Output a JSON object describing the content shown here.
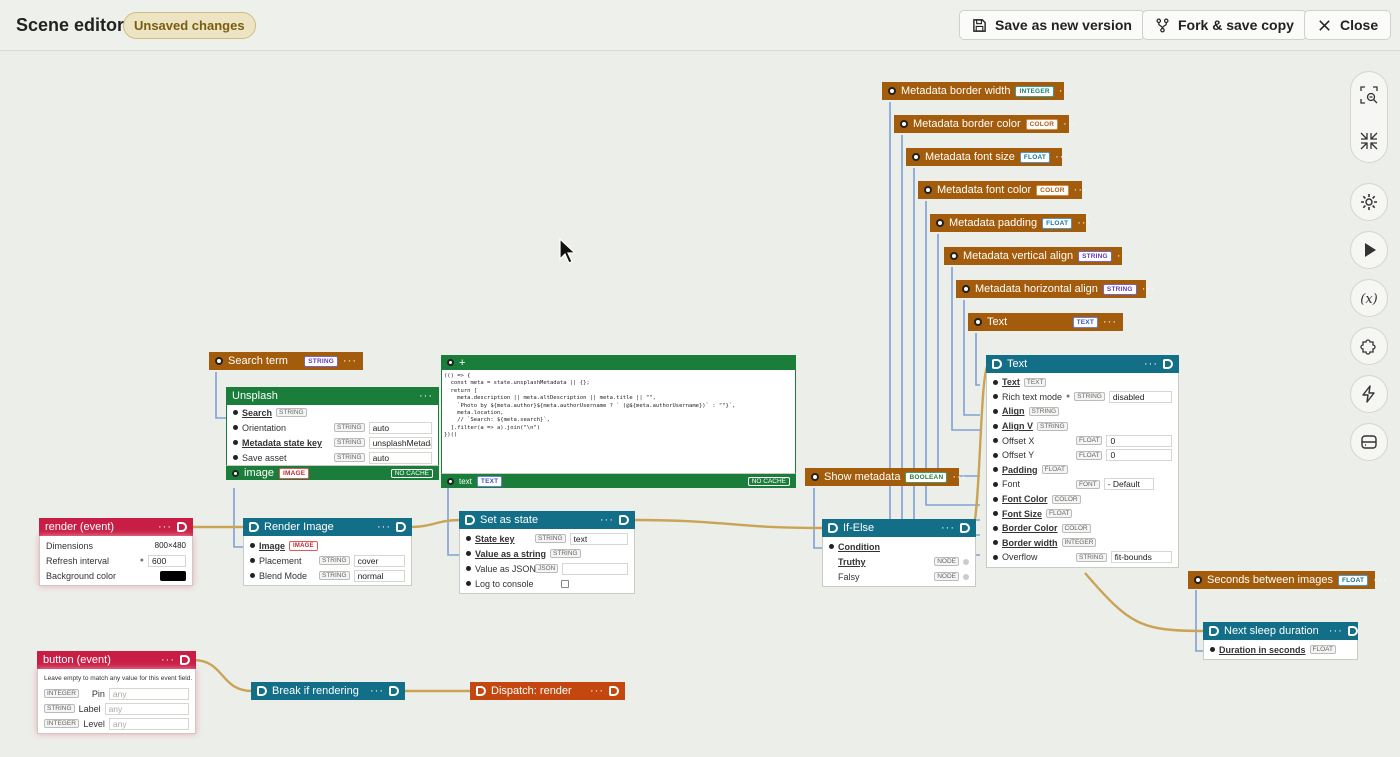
{
  "toolbar": {
    "title": "Scene editor",
    "unsaved": "Unsaved changes",
    "save_new": "Save as new version",
    "fork": "Fork & save copy",
    "close": "Close"
  },
  "nodes": {
    "md_border_width": {
      "label": "Metadata border width",
      "type": "INTEGER"
    },
    "md_border_color": {
      "label": "Metadata border color",
      "type": "COLOR"
    },
    "md_font_size": {
      "label": "Metadata font size",
      "type": "FLOAT"
    },
    "md_font_color": {
      "label": "Metadata font color",
      "type": "COLOR"
    },
    "md_padding": {
      "label": "Metadata padding",
      "type": "FLOAT"
    },
    "md_valign": {
      "label": "Metadata vertical align",
      "type": "STRING"
    },
    "md_halign": {
      "label": "Metadata horizontal align",
      "type": "STRING"
    },
    "text_var": {
      "label": "Text",
      "type": "TEXT"
    },
    "search_term": {
      "label": "Search term",
      "type": "STRING"
    },
    "show_metadata": {
      "label": "Show metadata",
      "type": "BOOLEAN"
    },
    "seconds_between": {
      "label": "Seconds between images",
      "type": "FLOAT"
    },
    "unsplash": {
      "title": "Unsplash",
      "rows": [
        {
          "label": "Search",
          "type": "STRING",
          "value": ""
        },
        {
          "label": "Orientation",
          "type": "STRING",
          "value": "auto"
        },
        {
          "label": "Metadata state key",
          "type": "STRING",
          "value": "unsplashMetadata"
        },
        {
          "label": "Save asset",
          "type": "STRING",
          "value": "auto"
        }
      ],
      "output": "image",
      "output_type": "IMAGE",
      "cache": "NO CACHE"
    },
    "code": {
      "title": "+",
      "lines": [
        "(() => {",
        "  const meta = state.unsplashMetadata || {};",
        "  return [",
        "    meta.description || meta.altDescription || meta.title || \"\",",
        "    `Photo by ${meta.author}${meta.authorUsername ? ` (@${meta.authorUsername})` : \"\"}`,",
        "    meta.location,",
        "    // `Search: ${meta.search}`,",
        "  ].filter(a => a).join(\"\\n\")",
        "})()"
      ],
      "output": "text",
      "output_type": "TEXT",
      "cache": "NO CACHE"
    },
    "text_node": {
      "title": "Text",
      "rows": [
        {
          "label": "Text",
          "type": "TEXT",
          "value": ""
        },
        {
          "label": "Rich text mode",
          "type": "STRING",
          "value": "disabled"
        },
        {
          "label": "Align",
          "type": "STRING",
          "value": ""
        },
        {
          "label": "Align V",
          "type": "STRING",
          "value": ""
        },
        {
          "label": "Offset X",
          "type": "FLOAT",
          "value": "0"
        },
        {
          "label": "Offset Y",
          "type": "FLOAT",
          "value": "0"
        },
        {
          "label": "Padding",
          "type": "FLOAT",
          "value": ""
        },
        {
          "label": "Font",
          "type": "FONT",
          "value": "- Default"
        },
        {
          "label": "Font Color",
          "type": "COLOR",
          "value": ""
        },
        {
          "label": "Font Size",
          "type": "FLOAT",
          "value": ""
        },
        {
          "label": "Border Color",
          "type": "COLOR",
          "value": ""
        },
        {
          "label": "Border width",
          "type": "INTEGER",
          "value": ""
        },
        {
          "label": "Overflow",
          "type": "STRING",
          "value": "fit-bounds"
        }
      ]
    },
    "render_event": {
      "title": "render (event)",
      "rows": [
        {
          "label": "Dimensions",
          "value": "800×480"
        },
        {
          "label": "Refresh interval",
          "value": "600"
        },
        {
          "label": "Background color",
          "value": ""
        }
      ],
      "bg_color": "#000000"
    },
    "render_image": {
      "title": "Render Image",
      "rows": [
        {
          "label": "Image",
          "type": "IMAGE",
          "value": ""
        },
        {
          "label": "Placement",
          "type": "STRING",
          "value": "cover"
        },
        {
          "label": "Blend Mode",
          "type": "STRING",
          "value": "normal"
        }
      ]
    },
    "set_state": {
      "title": "Set as state",
      "rows": [
        {
          "label": "State key",
          "type": "STRING",
          "value": "text"
        },
        {
          "label": "Value as a string",
          "type": "STRING",
          "value": ""
        },
        {
          "label": "Value as JSON",
          "type": "JSON",
          "value": ""
        },
        {
          "label": "Log to console",
          "type": "",
          "value": ""
        }
      ]
    },
    "if_else": {
      "title": "If-Else",
      "rows": [
        {
          "label": "Condition",
          "type": ""
        },
        {
          "label": "Truthy",
          "type": "NODE"
        },
        {
          "label": "Falsy",
          "type": "NODE"
        }
      ]
    },
    "next_sleep": {
      "title": "Next sleep duration",
      "rows": [
        {
          "label": "Duration in seconds",
          "type": "FLOAT"
        }
      ]
    },
    "button_event": {
      "title": "button (event)",
      "hint": "Leave empty to match any value for this event field.",
      "rows": [
        {
          "type": "INTEGER",
          "label": "Pin",
          "placeholder": "any"
        },
        {
          "type": "STRING",
          "label": "Label",
          "placeholder": "any"
        },
        {
          "type": "INTEGER",
          "label": "Level",
          "placeholder": "any"
        }
      ]
    },
    "break_rendering": {
      "title": "Break if rendering"
    },
    "dispatch": {
      "title": "Dispatch: render"
    }
  },
  "rail_icons": [
    "zoom-fit-icon",
    "collapse-icon",
    "settings-icon",
    "play-icon",
    "variable-icon",
    "puzzle-icon",
    "lightning-icon",
    "database-icon"
  ],
  "colors": {
    "state_node": "#a35c0b",
    "app_node": "#1a7d3a",
    "code_node": "#136e88",
    "event_node": "#c81e45",
    "dispatch_node": "#c4470f",
    "flow_wire": "#c9a455",
    "data_wire": "#7ea0d6"
  }
}
